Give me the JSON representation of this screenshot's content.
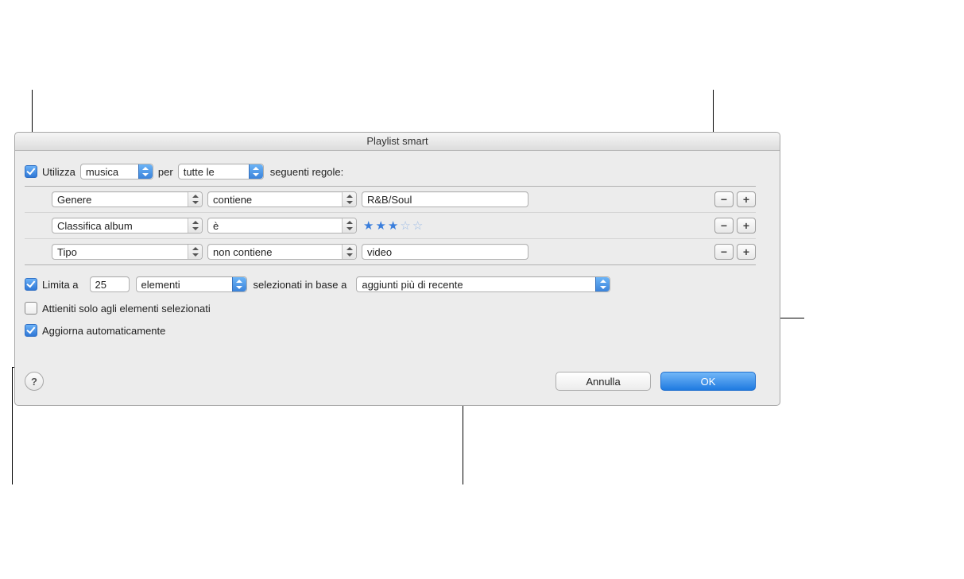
{
  "dialog": {
    "title": "Playlist smart"
  },
  "match": {
    "use_label": "Utilizza",
    "source": "musica",
    "per_label": "per",
    "scope": "tutte le",
    "suffix_label": "seguenti regole:",
    "checked": true
  },
  "rules": [
    {
      "field": "Genere",
      "op": "contiene",
      "value": "R&B/Soul",
      "type": "text"
    },
    {
      "field": "Classifica album",
      "op": "è",
      "stars": 3,
      "type": "stars"
    },
    {
      "field": "Tipo",
      "op": "non contiene",
      "value": "video",
      "type": "text"
    }
  ],
  "limit": {
    "checked": true,
    "label": "Limita a",
    "count": "25",
    "units": "elementi",
    "by_label": "selezionati in base a",
    "sort": "aggiunti più di recente"
  },
  "only_checked": {
    "checked": false,
    "label": "Attieniti solo agli elementi selezionati"
  },
  "live_update": {
    "checked": true,
    "label": "Aggiorna automaticamente"
  },
  "buttons": {
    "help": "?",
    "cancel": "Annulla",
    "ok": "OK",
    "remove": "−",
    "add": "+"
  }
}
